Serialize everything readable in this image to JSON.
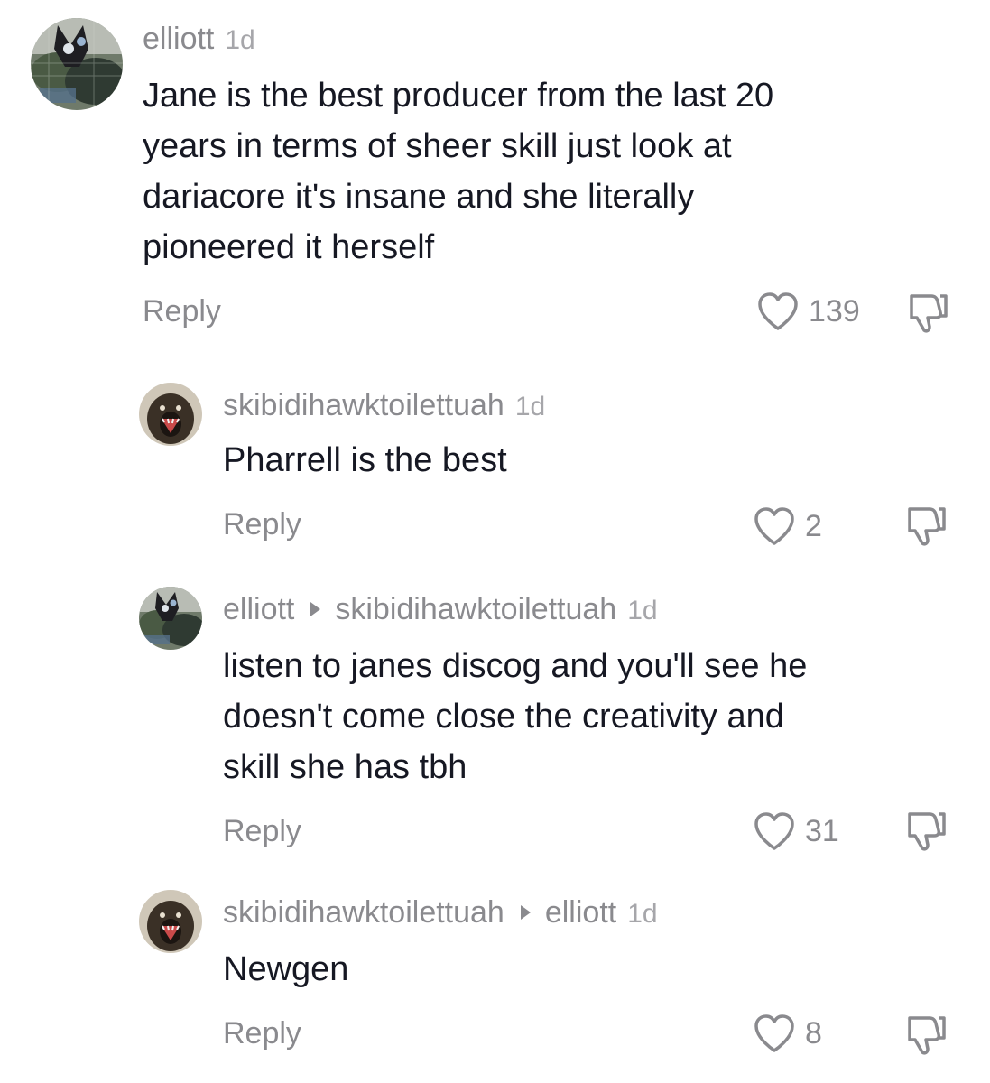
{
  "comments": [
    {
      "username": "elliott",
      "reply_to": "",
      "time": "1d",
      "text_lines": [
        "Jane is the best producer from the last 20",
        "years in terms of sheer skill just look at",
        "dariacore it's insane and she literally",
        "pioneered it herself"
      ],
      "reply_label": "Reply",
      "likes": "139"
    },
    {
      "username": "skibidihawktoilettuah",
      "reply_to": "",
      "time": "1d",
      "text_lines": [
        "Pharrell is the best"
      ],
      "reply_label": "Reply",
      "likes": "2"
    },
    {
      "username": "elliott",
      "reply_to": "skibidihawktoilettuah",
      "time": "1d",
      "text_lines": [
        "listen to janes discog and you'll see he",
        "doesn't come close the creativity and",
        "skill she has tbh"
      ],
      "reply_label": "Reply",
      "likes": "31"
    },
    {
      "username": "skibidihawktoilettuah",
      "reply_to": "elliott",
      "time": "1d",
      "text_lines": [
        "Newgen"
      ],
      "reply_label": "Reply",
      "likes": "8"
    }
  ],
  "icons": {
    "like": "heart-outline-icon",
    "dislike": "thumbs-down-outline-icon",
    "reply_arrow": "triangle-right-icon"
  },
  "colors": {
    "text": "#161823",
    "secondary": "#8a8a8e",
    "timestamp": "#a6a6aa"
  }
}
